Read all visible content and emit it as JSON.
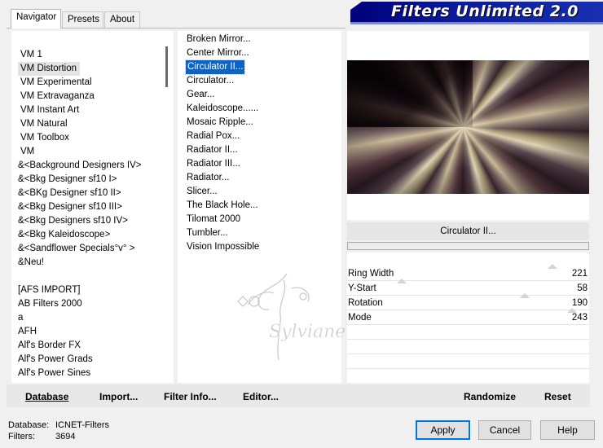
{
  "title": "Filters Unlimited 2.0",
  "tabs": [
    "Navigator",
    "Presets",
    "About"
  ],
  "categories": [
    "VM 1",
    "VM Distortion",
    "VM Experimental",
    "VM Extravaganza",
    "VM Instant Art",
    "VM Natural",
    "VM Toolbox",
    "VM",
    "&<Background Designers IV>",
    "&<Bkg Designer sf10 I>",
    "&<BKg Designer sf10 II>",
    "&<Bkg Designer sf10 III>",
    "&<Bkg Designers sf10 IV>",
    "&<Bkg Kaleidoscope>",
    "&<Sandflower Specials°v° >",
    "&Neu!",
    "",
    "[AFS IMPORT]",
    "AB Filters 2000",
    "a",
    "AFH",
    "Alf's Border FX",
    "Alf's Power Grads",
    "Alf's Power Sines"
  ],
  "filters": [
    "Broken Mirror...",
    "Center Mirror...",
    "Circulator II...",
    "Circulator...",
    "Gear...",
    "Kaleidoscope......",
    "Mosaic Ripple...",
    "Radial Pox...",
    "Radiator II...",
    "Radiator III...",
    "Radiator...",
    "Slicer...",
    "The Black Hole...",
    "Tilomat 2000",
    "Tumbler...",
    "Vision Impossible"
  ],
  "selected_filter": "Circulator II...",
  "params": [
    {
      "label": "Ring Width",
      "value": "221",
      "level": 0.87
    },
    {
      "label": "Y-Start",
      "value": "58",
      "level": 0.23
    },
    {
      "label": "Rotation",
      "value": "190",
      "level": 0.75
    },
    {
      "label": "Mode",
      "value": "243",
      "level": 0.95
    }
  ],
  "toolbar": {
    "database": "Database",
    "import": "Import...",
    "filter_info": "Filter Info...",
    "editor": "Editor...",
    "randomize": "Randomize",
    "reset": "Reset"
  },
  "status": {
    "database_label": "Database:",
    "database_value": "ICNET-Filters",
    "filters_label": "Filters:",
    "filters_value": "3694"
  },
  "buttons": {
    "apply": "Apply",
    "cancel": "Cancel",
    "help": "Help"
  },
  "watermark": "Sylviane",
  "colors": {
    "selection": "#0a64c8",
    "banner": "#00007a"
  }
}
